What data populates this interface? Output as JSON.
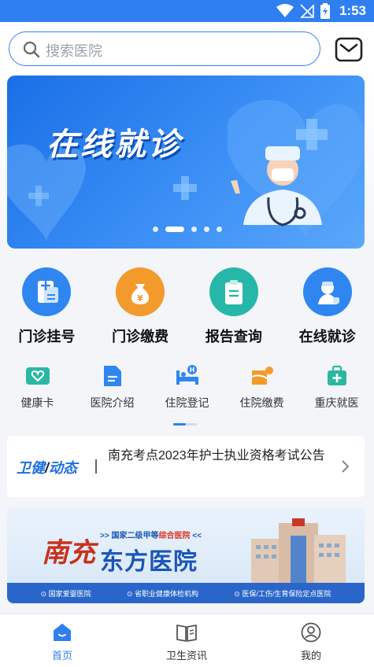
{
  "status_bar": {
    "time": "1:53"
  },
  "search": {
    "placeholder": "搜索医院"
  },
  "banner": {
    "title": "在线就诊",
    "pages": 5,
    "active_page": 2
  },
  "main_services": [
    {
      "label": "门诊挂号",
      "icon": "register-doc-icon",
      "color": "#2f86f0"
    },
    {
      "label": "门诊缴费",
      "icon": "money-bag-icon",
      "color": "#f39a2c"
    },
    {
      "label": "报告查询",
      "icon": "clipboard-icon",
      "color": "#27b7a8"
    },
    {
      "label": "在线就诊",
      "icon": "doctor-icon",
      "color": "#2f86f0"
    }
  ],
  "sub_services": [
    {
      "label": "健康卡",
      "icon": "health-card-icon",
      "color": "#2bb8a3"
    },
    {
      "label": "医院介绍",
      "icon": "document-icon",
      "color": "#2f86f0"
    },
    {
      "label": "住院登记",
      "icon": "hospital-bed-icon",
      "color": "#2f86f0"
    },
    {
      "label": "住院缴费",
      "icon": "payment-icon",
      "color": "#f39a2c"
    },
    {
      "label": "重庆就医",
      "icon": "medical-kit-icon",
      "color": "#2bb8a3"
    }
  ],
  "news": {
    "tag_left": "卫健",
    "tag_sep": "/",
    "tag_right": "动态",
    "headline": "南充考点2023年护士执业资格考试公告"
  },
  "ad": {
    "city": "南充",
    "subtitle_prefix": ">> 国家二级甲等",
    "subtitle_highlight": "综合医院",
    "subtitle_suffix": "<<",
    "hospital_name": "东方医院",
    "features": [
      "国家爱婴医院",
      "省职业健康体检机构",
      "医保/工伤/生育保险定点医院"
    ]
  },
  "tabs": [
    {
      "label": "首页",
      "icon": "home-icon",
      "active": true
    },
    {
      "label": "卫生资讯",
      "icon": "book-icon",
      "active": false
    },
    {
      "label": "我的",
      "icon": "user-icon",
      "active": false
    }
  ],
  "colors": {
    "primary": "#2f7ff0",
    "accent": "#f39a2c"
  }
}
